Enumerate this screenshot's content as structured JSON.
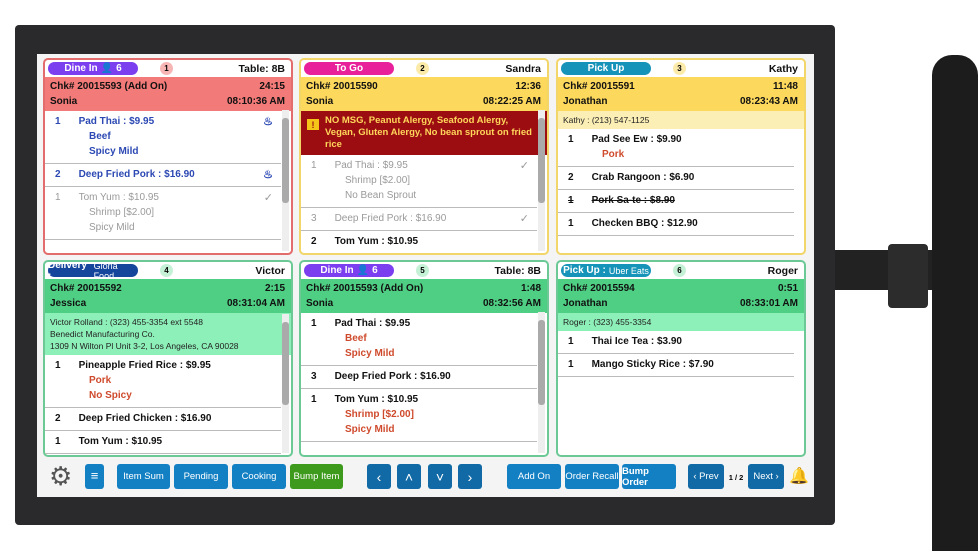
{
  "cards": [
    {
      "num": "1",
      "type": "Dine In",
      "guests": "6",
      "source": "",
      "right": "Table: 8B",
      "chk": "Chk# 20015593 (Add On)",
      "timer": "24:15",
      "server": "Sonia",
      "time": "08:10:36 AM",
      "theme": "red",
      "info": [],
      "alert": "",
      "scroll": true,
      "items": [
        {
          "qty": "1",
          "name": "Pad Thai : $9.95",
          "mods": [
            "Beef",
            "Spicy Mild"
          ],
          "state": "cooking",
          "icon": "cooking-icon"
        },
        {
          "qty": "2",
          "name": "Deep Fried Pork : $16.90",
          "mods": [],
          "state": "cooking",
          "icon": "cooking-icon"
        },
        {
          "qty": "1",
          "name": "Tom Yum : $10.95",
          "mods": [
            "Shrimp [$2.00]",
            "Spicy Mild"
          ],
          "state": "done",
          "icon": "check-icon"
        }
      ]
    },
    {
      "num": "2",
      "type": "To Go",
      "guests": "",
      "source": "",
      "right": "Sandra",
      "chk": "Chk# 20015590",
      "timer": "12:36",
      "server": "Sonia",
      "time": "08:22:25 AM",
      "theme": "yellow",
      "info": [],
      "alert": "NO MSG, Peanut Alergy, Seafood Alergy, Vegan, Gluten Alergy, No bean sprout on fried rice",
      "scroll": true,
      "items": [
        {
          "qty": "1",
          "name": "Pad Thai : $9.95",
          "mods": [
            "Shrimp [$2.00]",
            "No Bean Sprout"
          ],
          "state": "done",
          "icon": "check-icon"
        },
        {
          "qty": "3",
          "name": "Deep Fried Pork : $16.90",
          "mods": [],
          "state": "done",
          "icon": "check-icon"
        },
        {
          "qty": "2",
          "name": "Tom Yum : $10.95",
          "mods": [],
          "state": "new",
          "icon": ""
        }
      ]
    },
    {
      "num": "3",
      "type": "Pick Up",
      "guests": "",
      "source": "",
      "right": "Kathy",
      "chk": "Chk# 20015591",
      "timer": "11:48",
      "server": "Jonathan",
      "time": "08:23:43 AM",
      "theme": "yellow2",
      "info": [
        "Kathy : (213) 547-1125"
      ],
      "alert": "",
      "scroll": false,
      "items": [
        {
          "qty": "1",
          "name": "Pad See Ew : $9.90",
          "mods": [
            "Pork"
          ],
          "state": "new",
          "icon": ""
        },
        {
          "qty": "2",
          "name": "Crab Rangoon : $6.90",
          "mods": [],
          "state": "new",
          "icon": ""
        },
        {
          "qty": "1",
          "name": "Pork Sa-te : $8.90",
          "mods": [],
          "state": "new void",
          "icon": ""
        },
        {
          "qty": "1",
          "name": "Checken BBQ : $12.90",
          "mods": [],
          "state": "new",
          "icon": ""
        }
      ]
    },
    {
      "num": "4",
      "type": "Delivery :",
      "guests": "",
      "source": "Gloria Food",
      "right": "Victor",
      "chk": "Chk# 20015592",
      "timer": "2:15",
      "server": "Jessica",
      "time": "08:31:04 AM",
      "theme": "green",
      "info": [
        "Victor Rolland : (323) 455-3354 ext 5548",
        "Benedict Manufacturing Co.",
        "1309 N Wilton Pl Unit 3-2, Los Angeles, CA 90028"
      ],
      "alert": "",
      "scroll": true,
      "items": [
        {
          "qty": "1",
          "name": "Pineapple Fried Rice : $9.95",
          "mods": [
            "Pork",
            "No Spicy"
          ],
          "state": "new",
          "icon": ""
        },
        {
          "qty": "2",
          "name": "Deep Fried Chicken : $16.90",
          "mods": [],
          "state": "new",
          "icon": ""
        },
        {
          "qty": "1",
          "name": "Tom Yum : $10.95",
          "mods": [],
          "state": "new",
          "icon": ""
        }
      ]
    },
    {
      "num": "5",
      "type": "Dine In",
      "guests": "6",
      "source": "",
      "right": "Table: 8B",
      "chk": "Chk# 20015593 (Add On)",
      "timer": "1:48",
      "server": "Sonia",
      "time": "08:32:56 AM",
      "theme": "green",
      "info": [],
      "alert": "",
      "scroll": true,
      "items": [
        {
          "qty": "1",
          "name": "Pad Thai : $9.95",
          "mods": [
            "Beef",
            "Spicy Mild"
          ],
          "state": "new",
          "icon": ""
        },
        {
          "qty": "3",
          "name": "Deep Fried Pork : $16.90",
          "mods": [],
          "state": "new",
          "icon": ""
        },
        {
          "qty": "1",
          "name": "Tom Yum : $10.95",
          "mods": [
            "Shrimp [$2.00]",
            "Spicy Mild"
          ],
          "state": "new",
          "icon": ""
        }
      ]
    },
    {
      "num": "6",
      "type": "Pick Up :",
      "guests": "",
      "source": "Uber Eats",
      "right": "Roger",
      "chk": "Chk# 20015594",
      "timer": "0:51",
      "server": "Jonathan",
      "time": "08:33:01 AM",
      "theme": "green",
      "info": [
        "Roger : (323) 455-3354"
      ],
      "alert": "",
      "scroll": false,
      "items": [
        {
          "qty": "1",
          "name": "Thai Ice Tea : $3.90",
          "mods": [],
          "state": "new",
          "icon": ""
        },
        {
          "qty": "1",
          "name": "Mango Sticky Rice : $7.90",
          "mods": [],
          "state": "new",
          "icon": ""
        }
      ]
    }
  ],
  "pill_colors": {
    "Dine In": "#7b3ff0",
    "To Go": "#e8209a",
    "Pick Up": "#1593b8",
    "Delivery :": "#16459c",
    "Pick Up :": "#1593b8"
  },
  "toolbar": {
    "item_sum": "Item Sum",
    "pending": "Pending",
    "cooking": "Cooking",
    "bump_item": "Bump Item",
    "add_on": "Add On",
    "order_recall": "Order Recall",
    "bump_order": "Bump Order",
    "prev": "‹ Prev",
    "page": "1 / 2",
    "next": "Next ›"
  }
}
